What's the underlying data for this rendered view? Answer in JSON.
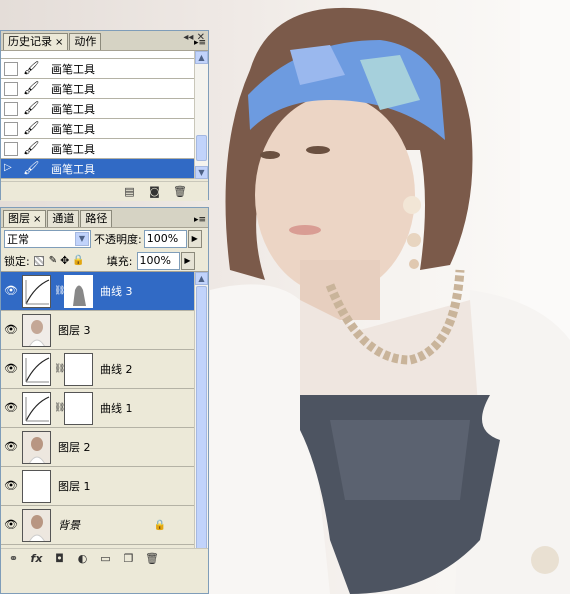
{
  "history_panel": {
    "tabs": [
      {
        "label": "历史记录",
        "close": "×"
      },
      {
        "label": "动作"
      }
    ],
    "items": [
      {
        "label": "画笔工具"
      },
      {
        "label": "画笔工具"
      },
      {
        "label": "画笔工具"
      },
      {
        "label": "画笔工具"
      },
      {
        "label": "画笔工具"
      },
      {
        "label": "画笔工具"
      }
    ]
  },
  "layers_panel": {
    "tabs": [
      {
        "label": "图层",
        "close": "×"
      },
      {
        "label": "通道"
      },
      {
        "label": "路径"
      }
    ],
    "blend_mode": "正常",
    "opacity_label": "不透明度:",
    "opacity_value": "100%",
    "lock_label": "锁定:",
    "fill_label": "填充:",
    "fill_value": "100%",
    "layers": [
      {
        "name": "曲线 3",
        "type": "curves",
        "selected": true
      },
      {
        "name": "图层 3",
        "type": "photo"
      },
      {
        "name": "曲线 2",
        "type": "curves"
      },
      {
        "name": "曲线 1",
        "type": "curves"
      },
      {
        "name": "图层 2",
        "type": "photo"
      },
      {
        "name": "图层 1",
        "type": "white"
      },
      {
        "name": "背景",
        "type": "photo",
        "locked": true
      }
    ]
  },
  "colors": {
    "selection": "#316ac5",
    "panel_bg": "#ece9d8",
    "headband": "#5d8fd8"
  },
  "icons": [
    "brush-icon",
    "eye-icon",
    "chain-icon",
    "lock-icon",
    "fx-icon",
    "mask-icon",
    "adjustment-icon",
    "folder-icon",
    "new-layer-icon",
    "trash-icon",
    "link-icon",
    "snapshot-icon",
    "new-document-icon"
  ]
}
